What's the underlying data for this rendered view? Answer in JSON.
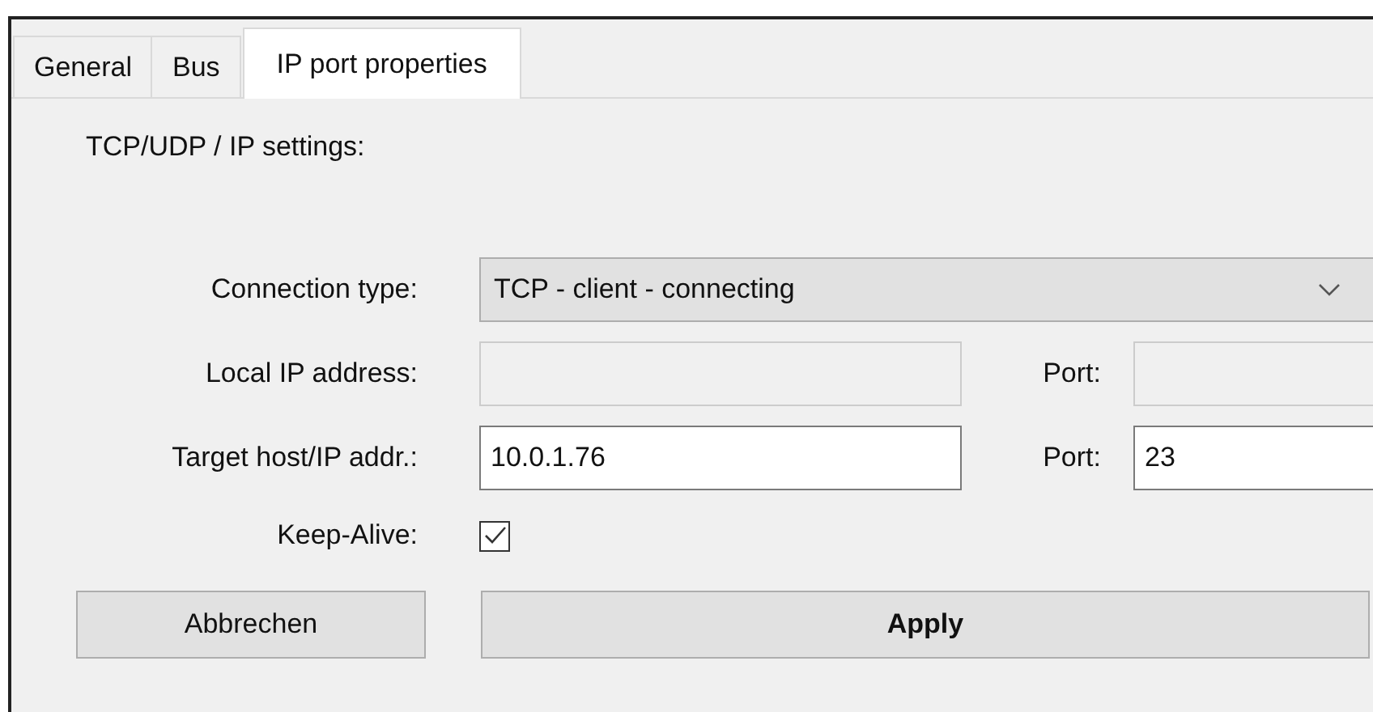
{
  "tabs": [
    {
      "label": "General",
      "selected": false
    },
    {
      "label": "Bus",
      "selected": false
    },
    {
      "label": "IP port properties",
      "selected": true
    }
  ],
  "section_title": "TCP/UDP / IP settings:",
  "connection_type": {
    "label": "Connection type:",
    "value": "TCP - client - connecting"
  },
  "address_rows": [
    {
      "label": "Local IP address:",
      "value": "",
      "disabled": true,
      "port_label": "Port:",
      "port_value": "",
      "port_disabled": true
    },
    {
      "label": "Target host/IP addr.:",
      "value": "10.0.1.76",
      "disabled": false,
      "port_label": "Port:",
      "port_value": "23",
      "port_disabled": false
    }
  ],
  "keep_alive": {
    "label": "Keep-Alive:",
    "checked": true
  },
  "buttons": [
    {
      "label": "Abbrechen",
      "kind": "normal"
    },
    {
      "label": "Apply",
      "kind": "primary"
    }
  ]
}
